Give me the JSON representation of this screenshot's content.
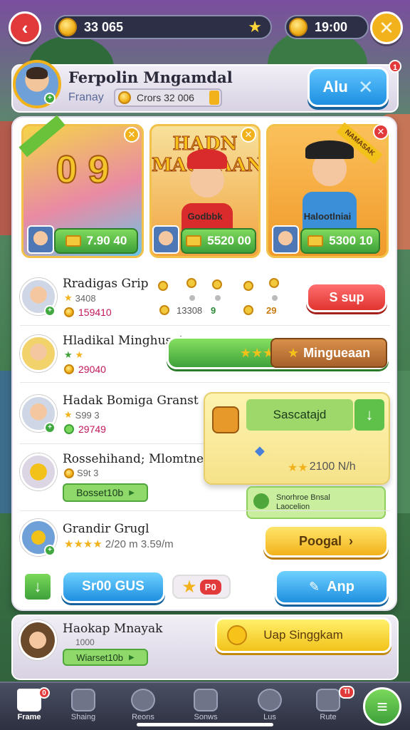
{
  "top_bar": {
    "coins": "33 065",
    "timer": "19:00"
  },
  "profile": {
    "name": "Ferpolin Mngamdal",
    "subtitle": "Franay",
    "coins_label": "Crors 32 006",
    "button_label": "Alu",
    "notification_count": "1"
  },
  "featured": [
    {
      "title": "",
      "big_text": "0 9",
      "caption": "",
      "price": "7.90 40"
    },
    {
      "title": "HADN MAGKAAN",
      "big_text": "",
      "caption": "Godbbk",
      "price": "5520 00"
    },
    {
      "title": "",
      "big_text": "",
      "caption": "Halootlniai",
      "price": "5300 10",
      "ribbon": "NAMASAK"
    }
  ],
  "rows": [
    {
      "name": "Rradigas Grip",
      "meta": "3408",
      "value": "159410",
      "action": "S sup",
      "extra_values": [
        "13308",
        "9",
        "29"
      ]
    },
    {
      "name": "Hladikal Minghusat",
      "meta": "",
      "value": "29040",
      "action": "Mingueaan"
    },
    {
      "name": "Hadak Bomiga Granst",
      "meta": "S99 3",
      "value": "29749"
    },
    {
      "name": "Rossehihand; Mlomtne",
      "meta": "S9t 3",
      "chip": "Bosset10b"
    },
    {
      "name": "Grandir Grugl",
      "meta": "2/20 m 3.59/m",
      "action": "Poogal"
    }
  ],
  "popup": {
    "field": "Sascatajd",
    "rating": "2100 N/h",
    "note_line1": "Snorhroe Bnsal",
    "note_line2": "Laocelion"
  },
  "actions": {
    "blue_button": "Sr00 GUS",
    "chip_badge": "P0",
    "right_button": "Anp"
  },
  "lower_card": {
    "name": "Haokap Mnayak",
    "sub": "1000",
    "chip": "Wiarset10b",
    "banner": "Uap Singgkam"
  },
  "nav": {
    "items": [
      {
        "label": "Frame",
        "badge": "0"
      },
      {
        "label": "Shaing"
      },
      {
        "label": "Reons"
      },
      {
        "label": "Sonws"
      },
      {
        "label": "Lus"
      },
      {
        "label": "Rute",
        "badge": "TI"
      }
    ]
  },
  "colors": {
    "primary_blue": "#1e8fe0",
    "primary_green": "#3ea13a",
    "accent_yellow": "#f2b21b",
    "accent_red": "#e23a3a"
  }
}
